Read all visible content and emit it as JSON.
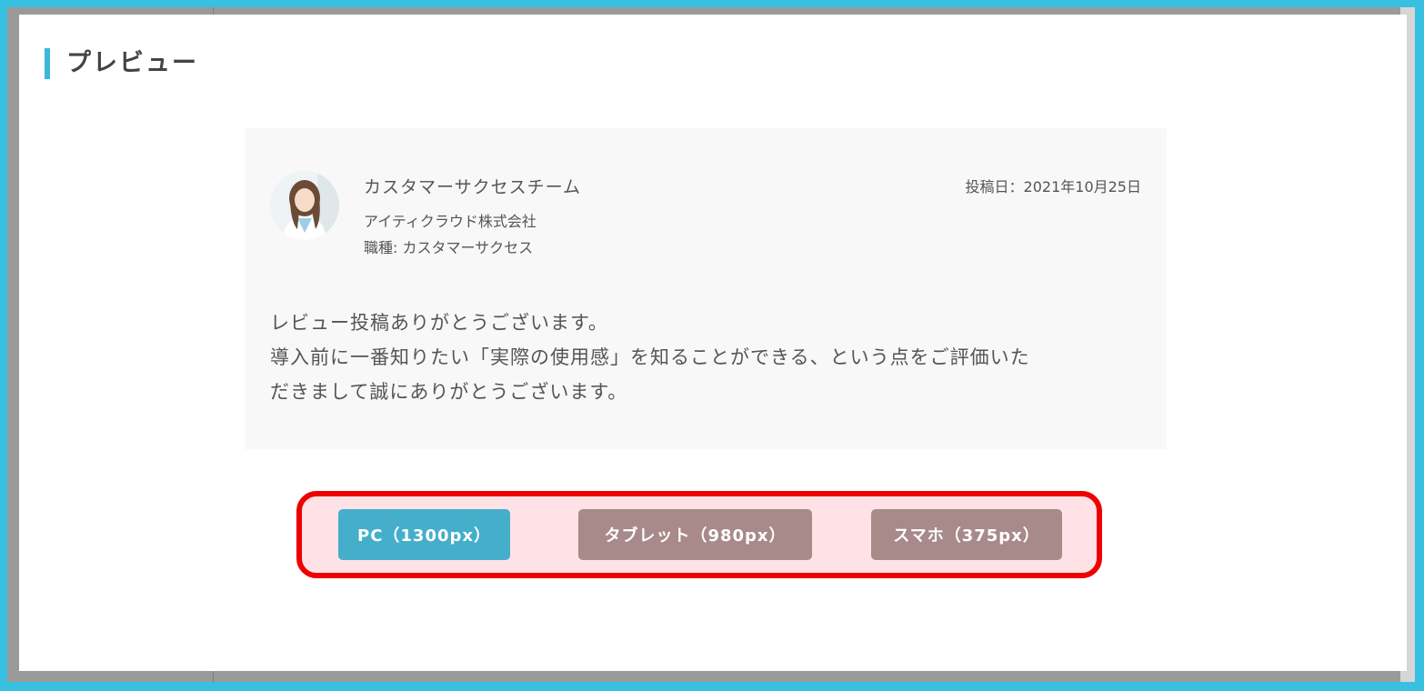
{
  "modal": {
    "title": "プレビュー"
  },
  "review": {
    "author_name": "カスタマーサクセスチーム",
    "company": "アイティクラウド株式会社",
    "role": "職種: カスタマーサクセス",
    "post_date": "投稿日：2021年10月25日",
    "body_lines": [
      "レビュー投稿ありがとうございます。",
      "導入前に一番知りたい「実際の使用感」を知ることができる、という点をご評価いた",
      "だきまして誠にありがとうございます。"
    ]
  },
  "preview_buttons": {
    "pc": "PC（1300px）",
    "tablet": "タブレット（980px）",
    "phone": "スマホ（375px）"
  },
  "colors": {
    "accent": "#3db7d9",
    "active_button": "#45aecb",
    "inactive_button": "#a88a8a",
    "highlight_border": "#ee0000",
    "highlight_fill": "#ffe2e5"
  }
}
